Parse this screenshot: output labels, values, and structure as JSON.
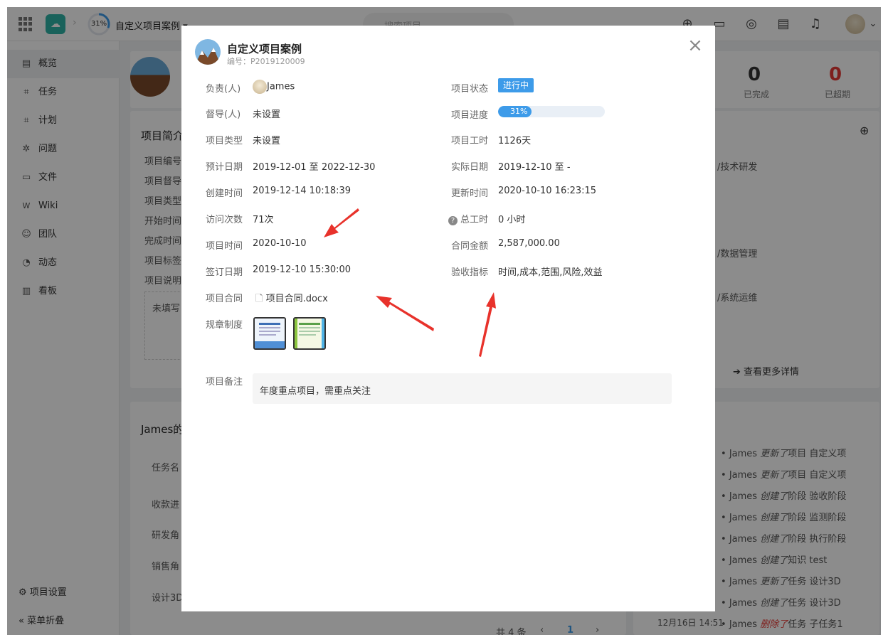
{
  "topbar": {
    "progress": "31%",
    "project_name": "自定义项目案例",
    "search_placeholder": "搜索项目"
  },
  "sidebar": {
    "items": [
      {
        "icon": "overview-icon",
        "label": "概览"
      },
      {
        "icon": "task-icon",
        "label": "任务"
      },
      {
        "icon": "plan-icon",
        "label": "计划"
      },
      {
        "icon": "bug-icon",
        "label": "问题"
      },
      {
        "icon": "folder-icon",
        "label": "文件"
      },
      {
        "icon": "wiki-icon",
        "label": "Wiki"
      },
      {
        "icon": "team-icon",
        "label": "团队"
      },
      {
        "icon": "activity-icon",
        "label": "动态"
      },
      {
        "icon": "board-icon",
        "label": "看板"
      }
    ],
    "settings": "项目设置",
    "collapse": "菜单折叠"
  },
  "background": {
    "intro_title": "项目简介",
    "intro_rows": [
      "项目编号",
      "项目督导",
      "项目类型",
      "开始时间",
      "完成时间",
      "项目标签",
      "项目说明"
    ],
    "intro_placeholder": "未填写",
    "stats": [
      {
        "value": "0",
        "label": "已完成",
        "color": "#333333"
      },
      {
        "value": "0",
        "label": "已超期",
        "color": "#e53935"
      }
    ],
    "right_items": [
      "/技术研发",
      "/数据管理",
      "/系统运维"
    ],
    "more_details": "查看更多详情",
    "tasks_title": "James的",
    "task_rows": [
      "任务名",
      "收款进",
      "研发角",
      "销售角",
      "设计3D"
    ],
    "pagination_total": "共 4 条",
    "pagination_page": "1",
    "activities": [
      {
        "user": "James",
        "action": "更新了",
        "text": "项目 自定义项"
      },
      {
        "user": "James",
        "action": "更新了",
        "text": "项目 自定义项"
      },
      {
        "user": "James",
        "action": "创建了",
        "text": "阶段 验收阶段"
      },
      {
        "user": "James",
        "action": "创建了",
        "text": "阶段 监测阶段"
      },
      {
        "user": "James",
        "action": "创建了",
        "text": "阶段 执行阶段"
      },
      {
        "user": "James",
        "action": "创建了",
        "text": "知识 test"
      },
      {
        "user": "James",
        "action": "更新了",
        "text": "任务 设计3D"
      },
      {
        "user": "James",
        "action": "创建了",
        "text": "任务 设计3D"
      },
      {
        "user": "James",
        "action": "删除了",
        "text": "任务 子任务1"
      }
    ],
    "activity_time": "12月16日 14:51"
  },
  "modal": {
    "title": "自定义项目案例",
    "code": "编号：P2019120009",
    "left": [
      {
        "label": "负责(人)",
        "value": "James"
      },
      {
        "label": "督导(人)",
        "value": "未设置"
      },
      {
        "label": "项目类型",
        "value": "未设置"
      },
      {
        "label": "预计日期",
        "value": "2019-12-01 至 2022-12-30"
      },
      {
        "label": "创建时间",
        "value": "2019-12-14 10:18:39"
      },
      {
        "label": "访问次数",
        "value": "71次"
      },
      {
        "label": "项目时间",
        "value": "2020-10-10"
      },
      {
        "label": "签订日期",
        "value": "2019-12-10 15:30:00"
      },
      {
        "label": "项目合同",
        "value": "项目合同.docx"
      },
      {
        "label": "规章制度",
        "value": ""
      }
    ],
    "right": [
      {
        "label": "项目状态",
        "value": "进行中"
      },
      {
        "label": "项目进度",
        "value": "31%"
      },
      {
        "label": "项目工时",
        "value": "1126天"
      },
      {
        "label": "实际日期",
        "value": "2019-12-10 至 -"
      },
      {
        "label": "更新时间",
        "value": "2020-10-10 16:23:15"
      },
      {
        "label": "总工时",
        "value": "0 小时"
      },
      {
        "label": "合同金额",
        "value": "2,587,000.00"
      },
      {
        "label": "验收指标",
        "value": "时间,成本,范围,风险,效益"
      }
    ],
    "progress_fraction": 0.31,
    "remark_label": "项目备注",
    "remark": "年度重点项目，需重点关注"
  }
}
